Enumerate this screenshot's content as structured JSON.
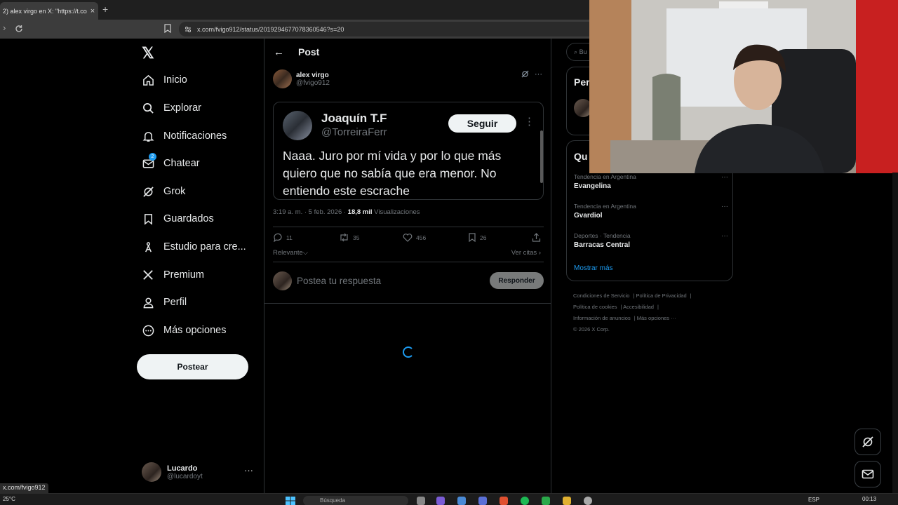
{
  "browser": {
    "tab_title": "2) alex virgo en X: \"https://t.co/",
    "tab_close": "×",
    "new_tab": "+",
    "url": "x.com/fvigo912/status/2019294677078360546?s=20",
    "status_url": "x.com/fvigo912"
  },
  "nav": {
    "items": [
      {
        "label": "Inicio",
        "icon": "home-icon"
      },
      {
        "label": "Explorar",
        "icon": "search-icon"
      },
      {
        "label": "Notificaciones",
        "icon": "bell-icon"
      },
      {
        "label": "Chatear",
        "icon": "mail-icon",
        "badge": "2"
      },
      {
        "label": "Grok",
        "icon": "grok-icon"
      },
      {
        "label": "Guardados",
        "icon": "bookmark-icon"
      },
      {
        "label": "Estudio para cre...",
        "icon": "creator-studio-icon"
      },
      {
        "label": "Premium",
        "icon": "x-logo-icon"
      },
      {
        "label": "Perfil",
        "icon": "person-icon"
      },
      {
        "label": "Más opciones",
        "icon": "more-circle-icon"
      }
    ],
    "post_button": "Postear",
    "account": {
      "name": "Lucardo",
      "handle": "@lucardoyt",
      "more": "···"
    }
  },
  "post": {
    "header_title": "Post",
    "author": {
      "name": "alex virgo",
      "handle": "@fvigo912"
    },
    "quote": {
      "name": "Joaquín T.F",
      "handle": "@TorreiraFerr",
      "follow_label": "Seguir",
      "text": "Naaa. Juro por mí vida y por lo que más quiero que no sabía que era menor. No entiendo este escrache"
    },
    "meta": {
      "time": "3:19 a. m. · 5 feb. 2026 · ",
      "views_count": "18,8 mil",
      "views_label": " Visualizaciones"
    },
    "actions": {
      "replies": "11",
      "reposts": "35",
      "likes": "456",
      "bookmarks": "26"
    },
    "sort_label": "Relevante",
    "quotes_link": "Ver citas",
    "reply_placeholder": "Postea tu respuesta",
    "reply_button": "Responder"
  },
  "sidebar": {
    "search_placeholder": "Bu",
    "top_card_heading": "Per",
    "trends_heading": "Qu",
    "trends": [
      {
        "context": "Tendencia en Argentina",
        "name": "Evangelina"
      },
      {
        "context": "Tendencia en Argentina",
        "name": "Gvardiol"
      },
      {
        "context": "Deportes · Tendencia",
        "name": "Barracas Central"
      }
    ],
    "show_more": "Mostrar más",
    "footer_links": [
      "Condiciones de Servicio",
      "Política de Privacidad",
      "Política de cookies",
      "Accesibilidad",
      "Información de anuncios",
      "Más opciones ···",
      "© 2026 X Corp."
    ]
  },
  "taskbar": {
    "weather": "25°C",
    "search": "Búsqueda",
    "lang": "ESP",
    "time": "00:13"
  },
  "colors": {
    "accent": "#1d9bf0",
    "background": "#000000",
    "border": "#2f3336",
    "muted": "#71767b"
  }
}
